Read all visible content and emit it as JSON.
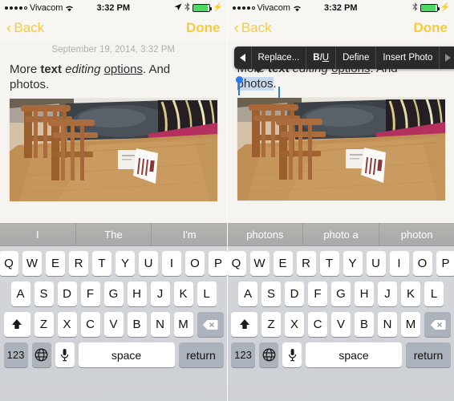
{
  "status": {
    "carrier": "Vivacom",
    "time": "3:32 PM",
    "signal_dots": 5,
    "signal_filled": 4,
    "wifi_icon": "wifi-icon",
    "location_icon": "location-arrow-icon",
    "bluetooth_icon": "bluetooth-icon",
    "battery_icon": "battery-icon",
    "battery_color": "#4cd964",
    "charging_icon": "charging-bolt-icon"
  },
  "nav": {
    "back_label": "Back",
    "done_label": "Done",
    "tint_color": "#f8cb3c"
  },
  "note": {
    "date": "September 19, 2014, 3:32 PM",
    "line1_plain_1": "More ",
    "line1_bold": "text",
    "line1_plain_2": " ",
    "line1_italic": "editing",
    "line1_plain_3": " ",
    "line1_underline": "options",
    "line1_plain_4": ". And",
    "line2": "photos.",
    "selection_word": "photos",
    "selection_color": "#c6d9ef",
    "handle_color": "#2b7bea"
  },
  "popup": {
    "prev_arrow": "left-triangle-icon",
    "items": [
      {
        "label": "Replace...",
        "name": "menu-item-replace"
      },
      {
        "label": "BIU",
        "name": "menu-item-format"
      },
      {
        "label": "Define",
        "name": "menu-item-define"
      },
      {
        "label": "Insert Photo",
        "name": "menu-item-insert-photo"
      }
    ],
    "format_b": "B",
    "format_i": "I",
    "format_u": "U",
    "next_arrow": "right-triangle-icon",
    "background": "#2a2a2a"
  },
  "keyboard": {
    "suggestions_left": [
      "I",
      "The",
      "I'm"
    ],
    "suggestions_right": [
      "photons",
      "photo a",
      "photon"
    ],
    "row1": [
      "Q",
      "W",
      "E",
      "R",
      "T",
      "Y",
      "U",
      "I",
      "O",
      "P"
    ],
    "row2": [
      "A",
      "S",
      "D",
      "F",
      "G",
      "H",
      "J",
      "K",
      "L"
    ],
    "row3": [
      "Z",
      "X",
      "C",
      "V",
      "B",
      "N",
      "M"
    ],
    "shift_icon": "shift-arrow-icon",
    "delete_icon": "backspace-icon",
    "numeric_label": "123",
    "globe_icon": "globe-icon",
    "mic_icon": "microphone-icon",
    "space_label": "space",
    "return_label": "return"
  }
}
